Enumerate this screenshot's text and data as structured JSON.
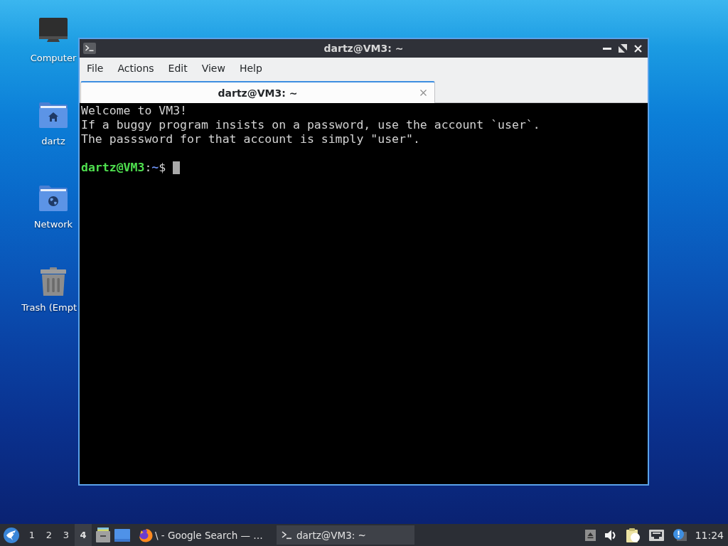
{
  "desktop_icons": [
    {
      "kind": "computer",
      "label": "Computer"
    },
    {
      "kind": "home_folder",
      "label": "dartz"
    },
    {
      "kind": "network_folder",
      "label": "Network"
    },
    {
      "kind": "trash",
      "label": "Trash (Empt"
    }
  ],
  "window": {
    "title": "dartz@VM3: ~",
    "menu": [
      "File",
      "Actions",
      "Edit",
      "View",
      "Help"
    ],
    "tabs": [
      {
        "label": "dartz@VM3: ~",
        "selected": true
      }
    ],
    "terminal": {
      "lines": [
        "Welcome to VM3!",
        "If a buggy program insists on a password, use the account `user`.",
        "The passsword for that account is simply \"user\"."
      ],
      "prompt": {
        "user_host": "dartz@VM3",
        "separator": ":",
        "path": "~",
        "symbol": "$"
      }
    }
  },
  "taskbar": {
    "workspaces": [
      {
        "label": "1",
        "selected": false
      },
      {
        "label": "2",
        "selected": false
      },
      {
        "label": "3",
        "selected": false
      },
      {
        "label": "4",
        "selected": true
      }
    ],
    "tasks": [
      {
        "kind": "browser",
        "label": "\\ - Google Search — …",
        "selected": false
      },
      {
        "kind": "terminal",
        "label": "dartz@VM3: ~",
        "selected": true
      }
    ],
    "clock": "11:24"
  }
}
